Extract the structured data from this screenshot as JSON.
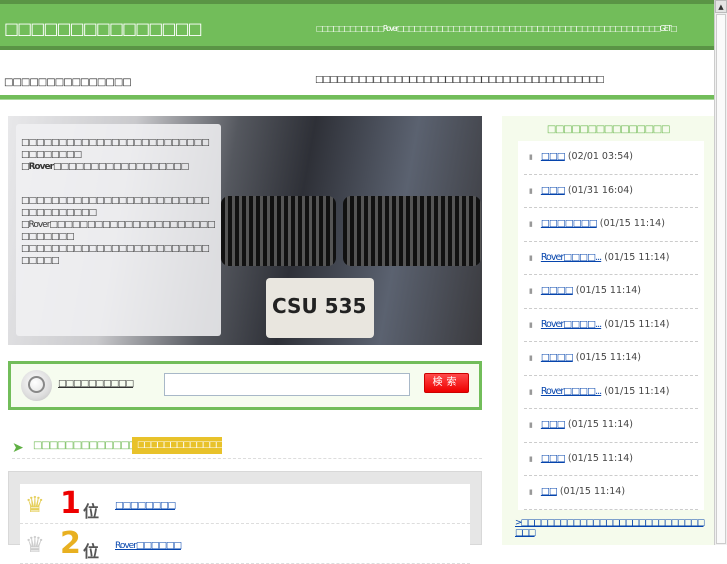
{
  "header": {
    "title": "□□□□□□□□□□□□□□□",
    "description": "□□□□□□□□□□□□Rover□□□□□□□□□□□□□□□□□□□□□□□□□□□□□□□□□□□□□□□□□□□□□□□GET□"
  },
  "subheader": {
    "left": "□□□□□□□□□□□□□□□",
    "right": "□□□□□□□□□□□□□□□□□□□□□□□□□□□□□□□□□□□□□□□□"
  },
  "hero": {
    "p1_line1": "□□□□□□□□□□□□□□□□□□□□□□□□□□□□□□□□□",
    "p1_line2": "□Rover□□□□□□□□□□□□□□□□□□",
    "p2_line1": "□□□□□□□□□□□□□□□□□□□□□□□□□□□□□□□□□□□",
    "p2_line2": "□Rover□□□□□□□□□□□□□□□□□□□□□□□□□□□□□",
    "p2_line3": "□□□□□□□□□□□□□□□□□□□□□□□□□□□□□□",
    "plate": "CSU 535"
  },
  "search": {
    "label": "□□□□□□□□□□",
    "placeholder": "",
    "button": "検索"
  },
  "ranking": {
    "title": "□□□□□□□□□□□□□□□",
    "badge": "□□□□□□□□□□□□□",
    "items": [
      {
        "rank": "1",
        "suffix": "位",
        "link": "□□□□□□□□"
      },
      {
        "rank": "2",
        "suffix": "位",
        "link": "Rover□□□□□□"
      }
    ]
  },
  "sidebar": {
    "title": "□□□□□□□□□□□□□□□",
    "items": [
      {
        "link": "□□□",
        "time": "(02/01 03:54)"
      },
      {
        "link": "□□□",
        "time": "(01/31 16:04)"
      },
      {
        "link": "□□□□□□□",
        "time": "(01/15 11:14)"
      },
      {
        "link": "Rover□□□□...",
        "time": "(01/15 11:14)"
      },
      {
        "link": "□□□□",
        "time": "(01/15 11:14)"
      },
      {
        "link": "Rover□□□□...",
        "time": "(01/15 11:14)"
      },
      {
        "link": "□□□□",
        "time": "(01/15 11:14)"
      },
      {
        "link": "Rover□□□□...",
        "time": "(01/15 11:14)"
      },
      {
        "link": "□□□",
        "time": "(01/15 11:14)"
      },
      {
        "link": "□□□",
        "time": "(01/15 11:14)"
      },
      {
        "link": "□□",
        "time": "(01/15 11:14)"
      }
    ],
    "more": ">□□□□□□□□□□□□□□□□□□□□□□□□□□□□□□□"
  }
}
